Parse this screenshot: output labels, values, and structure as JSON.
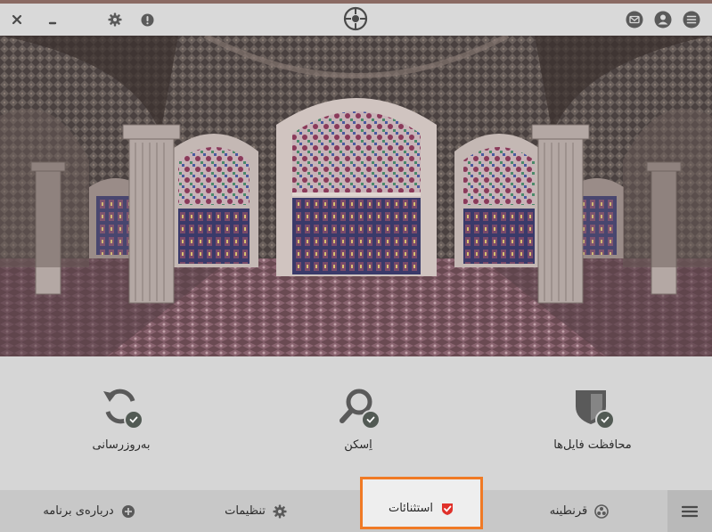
{
  "features": {
    "protection": "محافظت فایل‌ها",
    "scan": "اِسکن",
    "update": "به‌روزرسانی"
  },
  "nav": {
    "quarantine": "قرنطینه",
    "exceptions": "استثنائات",
    "settings": "تنظیمات",
    "about": "درباره‌ی برنامه"
  },
  "colors": {
    "accent": "#f07a25",
    "topline": "#8a6a63",
    "icon": "#5a5a5a",
    "icon_dark": "#4a4a4a",
    "check": "#525a54",
    "active_icon": "#e0312a"
  },
  "icons": {
    "close": "close-icon",
    "minimize": "minimize-icon",
    "settings": "gear-icon",
    "info": "info-icon",
    "logo": "crosshair-logo-icon",
    "mail": "mail-icon",
    "profile": "user-icon",
    "menu": "hamburger-icon"
  }
}
